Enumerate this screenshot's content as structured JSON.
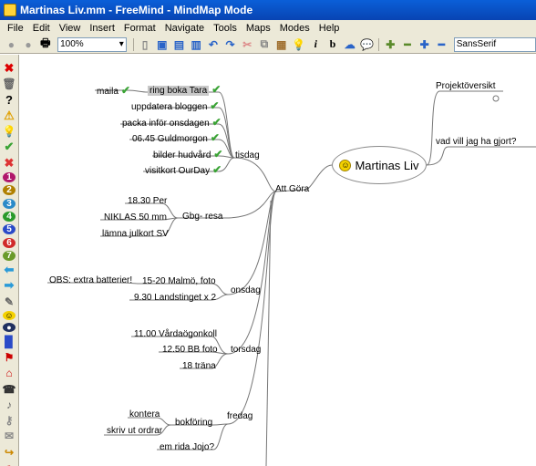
{
  "window": {
    "title": "Martinas Liv.mm - FreeMind - MindMap Mode"
  },
  "menu": [
    "File",
    "Edit",
    "View",
    "Insert",
    "Format",
    "Navigate",
    "Tools",
    "Maps",
    "Modes",
    "Help"
  ],
  "toolbar": {
    "zoom": "100%",
    "font": "SansSerif"
  },
  "mindmap": {
    "root": "Martinas Liv",
    "right": {
      "overview": "Projektöversikt",
      "what": "vad vill jag ha gjort?"
    },
    "att_gora": "Att Göra",
    "tisdag": {
      "label": "tisdag",
      "maila": "maila",
      "items": [
        "ring boka Tara",
        "uppdatera bloggen",
        "packa inför onsdagen",
        "06.45 Guldmorgon",
        "bilder hudvård",
        "visitkort OurDay"
      ]
    },
    "gbg": {
      "label": "Gbg- resa",
      "items": [
        "18.30 Per",
        "NIKLAS 50 mm",
        "lämna julkort SV"
      ]
    },
    "onsdag": {
      "label": "onsdag",
      "obs": "OBS: extra batterier!",
      "items": [
        "15-20 Malmö, foto",
        "9.30  Landstinget x 2"
      ]
    },
    "torsdag": {
      "label": "torsdag",
      "items": [
        "11.00 Vårdaögonkoll",
        "12.50 BB foto",
        "18 träna"
      ]
    },
    "fredag": {
      "label": "fredag",
      "bokforing": "bokföring",
      "bokforing_items": [
        "kontera",
        "skriv ut ordrar"
      ],
      "other": "em rida Jojo?"
    }
  }
}
